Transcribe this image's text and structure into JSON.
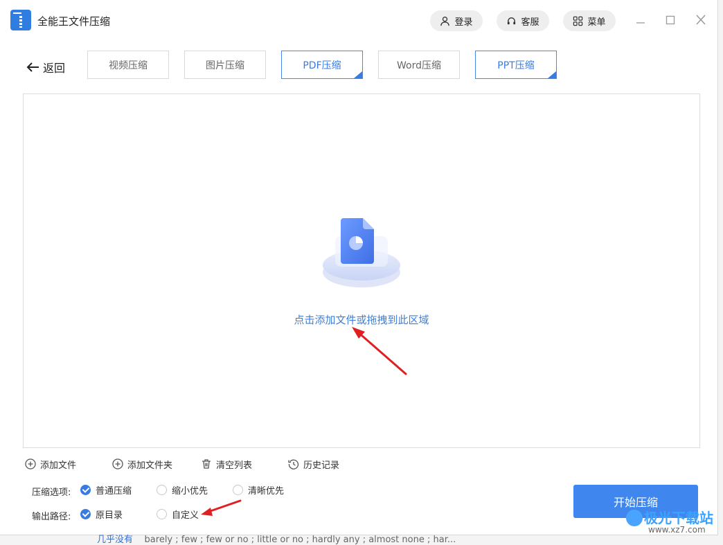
{
  "app": {
    "title": "全能王文件压缩"
  },
  "header": {
    "login_label": "登录",
    "service_label": "客服",
    "menu_label": "菜单"
  },
  "nav": {
    "back_label": "返回",
    "tabs": [
      {
        "label": "视频压缩",
        "active": false
      },
      {
        "label": "图片压缩",
        "active": false
      },
      {
        "label": "PDF压缩",
        "active": true
      },
      {
        "label": "Word压缩",
        "active": false
      },
      {
        "label": "PPT压缩",
        "active": true
      }
    ]
  },
  "dropzone": {
    "hint": "点击添加文件或拖拽到此区域"
  },
  "toolbar": {
    "add_file": "添加文件",
    "add_folder": "添加文件夹",
    "clear_list": "清空列表",
    "history": "历史记录"
  },
  "options": {
    "compress_label": "压缩选项:",
    "compress_choices": [
      {
        "label": "普通压缩",
        "checked": true
      },
      {
        "label": "缩小优先",
        "checked": false
      },
      {
        "label": "清晰优先",
        "checked": false
      }
    ],
    "output_label": "输出路径:",
    "output_choices": [
      {
        "label": "原目录",
        "checked": true
      },
      {
        "label": "自定义",
        "checked": false
      }
    ]
  },
  "start_button": "开始压缩",
  "background": {
    "left_text": "几乎没有",
    "right_text": "barely ; few ; few or no ; little or no ; hardly any ; almost none ; har..."
  },
  "watermark": {
    "text": "极光下载站",
    "url": "www.xz7.com"
  },
  "colors": {
    "accent": "#3f87ee",
    "annotation": "#e02020",
    "link": "#3d7fd9"
  }
}
